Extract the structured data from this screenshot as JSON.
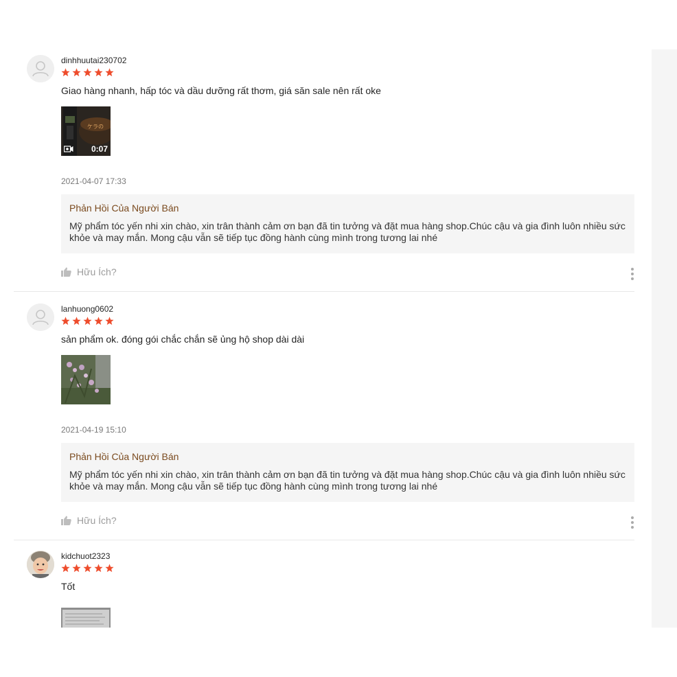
{
  "reviews": [
    {
      "username": "dinhhuutai230702",
      "comment": "Giao hàng nhanh, hấp tóc và dầu dưỡng rất thơm, giá săn sale nên rất oke",
      "media_type": "video",
      "video_duration": "0:07",
      "date": "2021-04-07 17:33",
      "reply_title": "Phản Hồi Của Người Bán",
      "reply_text": "Mỹ phẩm tóc yến nhi xin chào, xin trân thành cảm ơn bạn đã tin tưởng và đặt mua hàng shop.Chúc cậu và gia đình luôn nhiều sức khỏe và may mắn. Mong cậu vẫn sẽ tiếp tục đồng hành cùng mình trong tương lai nhé",
      "helpful_label": "Hữu Ích?",
      "rating": 5
    },
    {
      "username": "lanhuong0602",
      "comment": "sản phẩm ok. đóng gói chắc chắn sẽ ủng hộ shop dài dài",
      "media_type": "image",
      "date": "2021-04-19 15:10",
      "reply_title": "Phản Hồi Của Người Bán",
      "reply_text": "Mỹ phẩm tóc yến nhi xin chào, xin trân thành cảm ơn bạn đã tin tưởng và đặt mua hàng shop.Chúc cậu và gia đình luôn nhiều sức khỏe và may mắn. Mong cậu vẫn sẽ tiếp tục đồng hành cùng mình trong tương lai nhé",
      "helpful_label": "Hữu Ích?",
      "rating": 5
    },
    {
      "username": "kidchuot2323",
      "comment": "Tốt",
      "media_type": "image",
      "rating": 5
    }
  ],
  "colors": {
    "star": "#ee4d2d",
    "reply_title": "#7a4a1e",
    "reply_bg": "#f5f5f5"
  },
  "icons": {
    "avatar_default": "user-silhouette-icon",
    "star": "star-icon",
    "like": "thumbs-up-icon",
    "more": "more-vertical-icon",
    "camera": "video-camera-icon"
  }
}
